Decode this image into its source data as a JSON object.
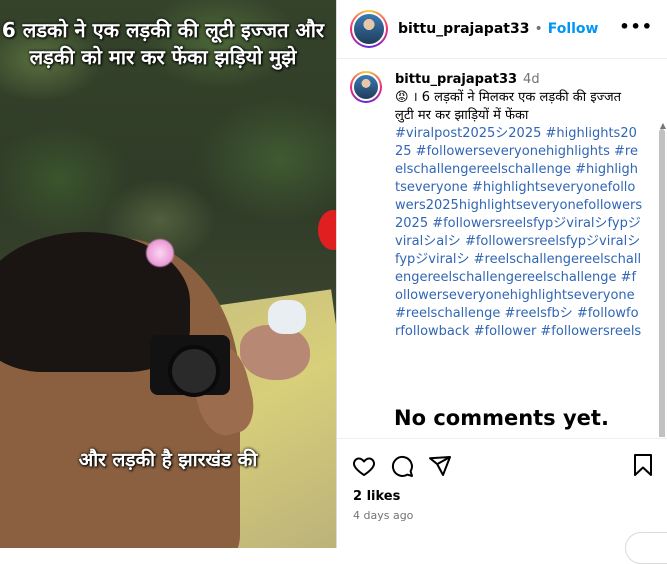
{
  "media": {
    "overlay_top": "6 लडको ने एक लड़की की लूटी इज्जत और लड़की को मार कर फेंका झड़ियो मुझे",
    "overlay_bottom": "और लड़की है झारखंड की"
  },
  "header": {
    "username": "bittu_prajapat33",
    "separator": "•",
    "follow_label": "Follow",
    "more_label": "•••"
  },
  "caption": {
    "username": "bittu_prajapat33",
    "time": "4d",
    "emoji": "😡",
    "text": "। 6 लड़कों ने मिलकर एक लड़की की इज्जत लुटी मर कर झाड़ियों में फेंका",
    "hashtags": "#viralpost2025シ2025 #highlights2025 #followerseveryonehighlights #reelschallengereelschallenge #highlightseveryone #highlightseveryonefollowers2025highlightseveryonefollowers2025 #followersreelsfypジviralシfypジviralシalシ #followersreelsfypジviralシfypジviralシ #reelschallengereelschallengereelschallengereelschallenge #followerseveryonehighlightseveryone #reelschallenge #reelsfbシ #followforfollowback #follower #followersreels"
  },
  "comments": {
    "empty_label": "No comments yet."
  },
  "actions": {
    "icons": [
      "heart-icon",
      "comment-icon",
      "share-icon",
      "bookmark-icon"
    ],
    "likes": "2 likes",
    "time_ago": "4 days ago"
  },
  "colors": {
    "link": "#0095f6",
    "hashtag": "#3166b5",
    "muted": "#737373"
  }
}
